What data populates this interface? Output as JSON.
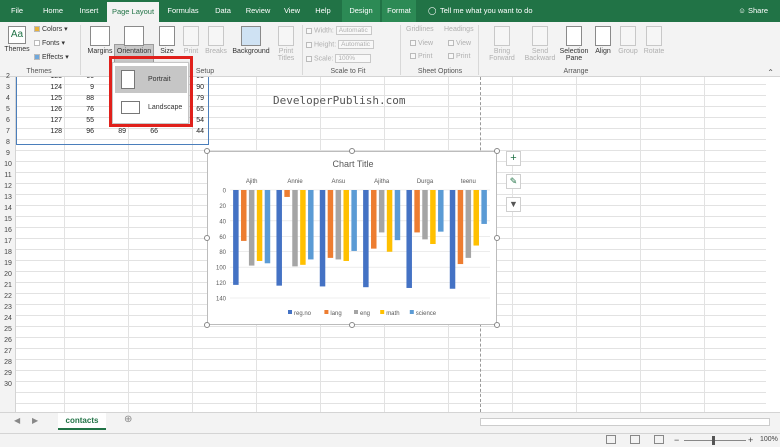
{
  "tabs": [
    {
      "label": "File"
    },
    {
      "label": "Home"
    },
    {
      "label": "Insert"
    },
    {
      "label": "Page Layout"
    },
    {
      "label": "Formulas"
    },
    {
      "label": "Data"
    },
    {
      "label": "Review"
    },
    {
      "label": "View"
    },
    {
      "label": "Help"
    },
    {
      "label": "Design"
    },
    {
      "label": "Format"
    }
  ],
  "tellme": "Tell me what you want to do",
  "share": "Share",
  "ribbon": {
    "themes": "Themes",
    "colors": "Colors",
    "fonts": "Fonts",
    "effects": "Effects",
    "margins": "Margins",
    "orientation": "Orientation",
    "size": "Size",
    "print_area": "Print",
    "breaks": "Breaks",
    "background": "Background",
    "print_titles": "Print",
    "print_titles2": "Titles",
    "width_label": "Width:",
    "width_value": "Automatic",
    "height_label": "Height:",
    "height_value": "Automatic",
    "scale_label": "Scale:",
    "scale_value": "100%",
    "gridlines": "Gridlines",
    "headings": "Headings",
    "view": "View",
    "print": "Print",
    "bring_forward": "Bring",
    "bring_forward2": "Forward",
    "send_backward": "Send",
    "send_backward2": "Backward",
    "selection_pane": "Selection",
    "selection_pane2": "Pane",
    "align": "Align",
    "group": "Group",
    "rotate": "Rotate",
    "grp_themes": "Themes",
    "grp_setup": "Setup",
    "grp_scale": "Scale to Fit",
    "grp_sheet": "Sheet Options",
    "grp_arrange": "Arrange"
  },
  "orientation_menu": {
    "portrait": "Portrait",
    "landscape": "Landscape"
  },
  "watermark": "DeveloperPublish.com",
  "rows": [
    "2",
    "3",
    "4",
    "5",
    "6",
    "7",
    "8",
    "9",
    "10",
    "11",
    "12",
    "13",
    "14",
    "15",
    "16",
    "17",
    "18",
    "19",
    "20",
    "21",
    "22",
    "23",
    "24",
    "25",
    "26",
    "27",
    "28",
    "29",
    "30"
  ],
  "table": [
    [
      "123",
      "66",
      "",
      "",
      "95"
    ],
    [
      "124",
      "9",
      "",
      "",
      "90"
    ],
    [
      "125",
      "88",
      "",
      "",
      "79"
    ],
    [
      "126",
      "76",
      "",
      "",
      "65"
    ],
    [
      "127",
      "55",
      "80",
      "70",
      "54"
    ],
    [
      "128",
      "96",
      "89",
      "66",
      "44"
    ]
  ],
  "chart_data": {
    "type": "bar",
    "title": "Chart Title",
    "categories": [
      "Ajith",
      "Annie",
      "Ansu",
      "Ajitha",
      "Durga",
      "teenu"
    ],
    "ylim": [
      0,
      140
    ],
    "y_reversed": true,
    "yticks": [
      "0",
      "20",
      "40",
      "60",
      "80",
      "100",
      "120",
      "140"
    ],
    "legend_position": "bottom",
    "series": [
      {
        "name": "reg.no",
        "color": "#4472c4",
        "values": [
          123,
          124,
          125,
          126,
          127,
          128
        ]
      },
      {
        "name": "lang",
        "color": "#ed7d31",
        "values": [
          66,
          9,
          88,
          76,
          55,
          96
        ]
      },
      {
        "name": "eng",
        "color": "#a5a5a5",
        "values": [
          98,
          99,
          90,
          55,
          64,
          88
        ]
      },
      {
        "name": "math",
        "color": "#ffc000",
        "values": [
          92,
          97,
          92,
          80,
          70,
          72
        ]
      },
      {
        "name": "science",
        "color": "#5b9bd5",
        "values": [
          95,
          90,
          79,
          65,
          54,
          44
        ]
      }
    ]
  },
  "sheet_tab": "contacts",
  "zoom": "100%"
}
